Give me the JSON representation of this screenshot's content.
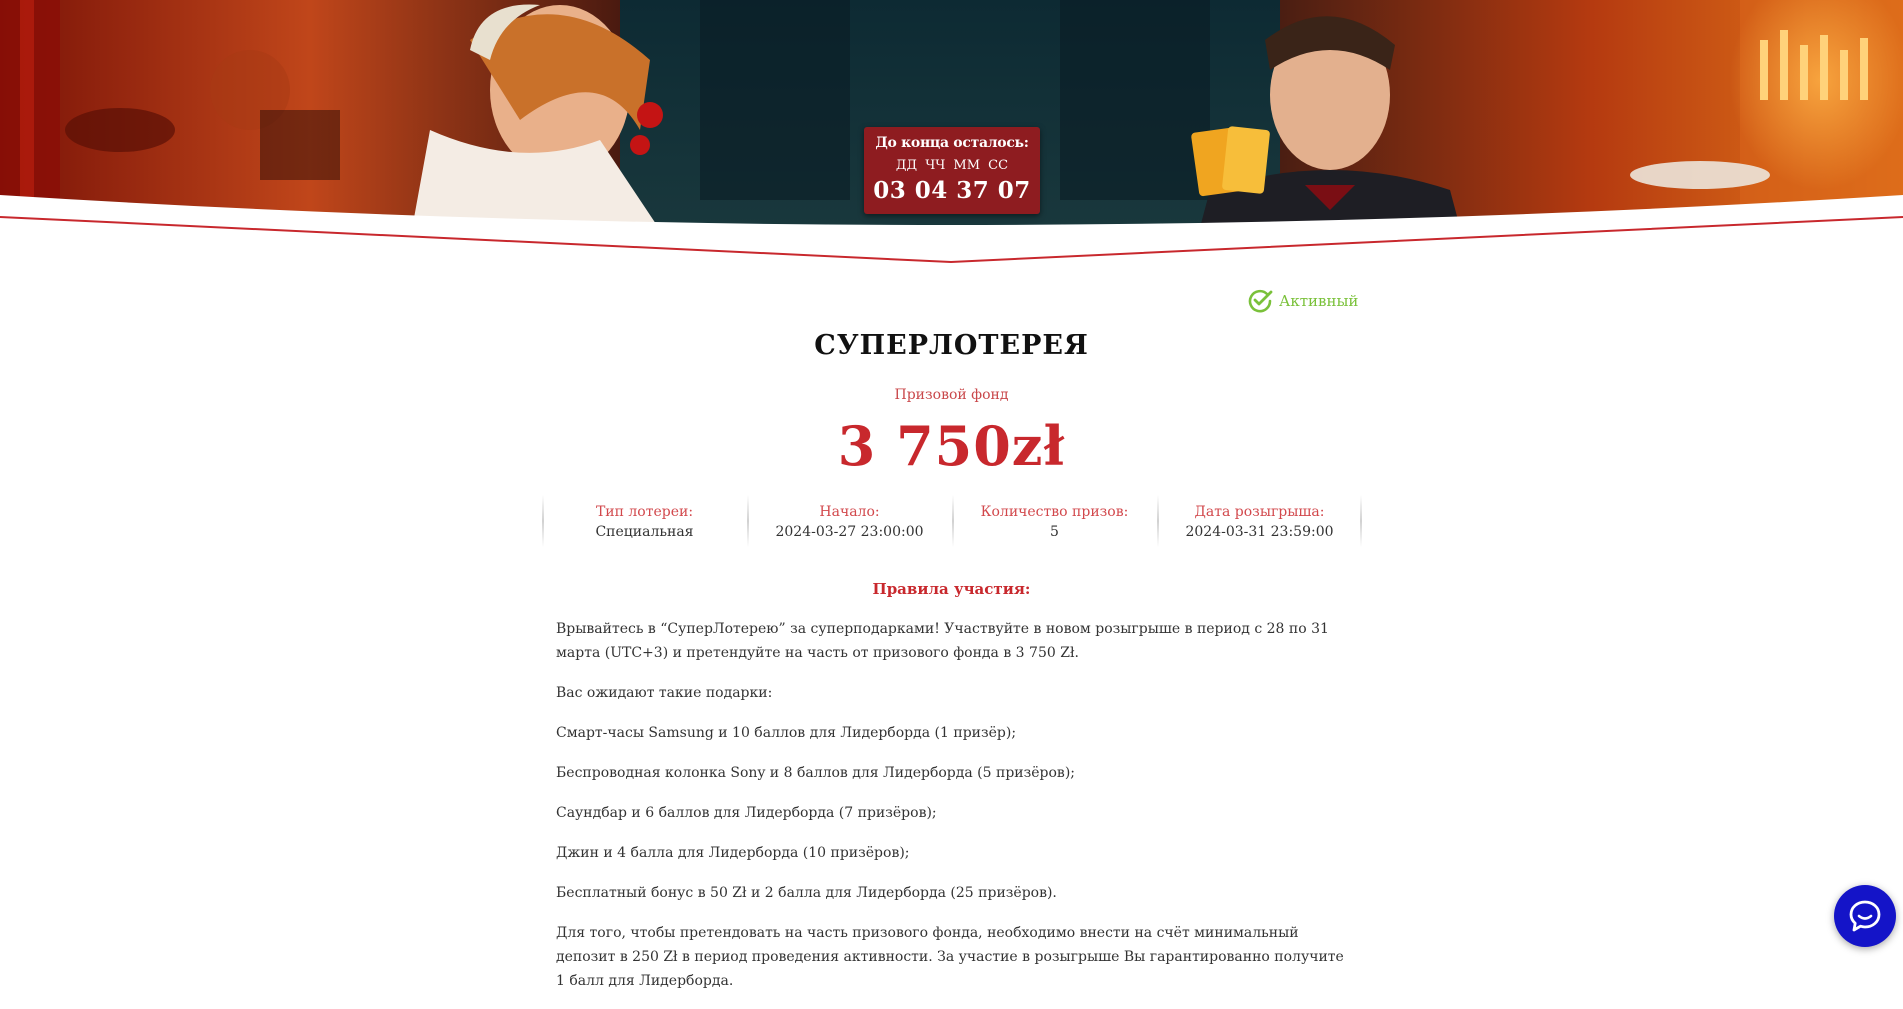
{
  "countdown": {
    "title": "До конца осталось:",
    "units": "ДД  ЧЧ  ММ  СС",
    "value": "03 04 37 07"
  },
  "status": {
    "label": "Активный",
    "color": "#7ac13a"
  },
  "lottery": {
    "title": "СУПЕРЛОТЕРЕЯ",
    "prize_fund_label": "Призовой фонд",
    "prize_fund_value": "3 750zł"
  },
  "info": [
    {
      "label": "Тип лотереи:",
      "value": "Специальная"
    },
    {
      "label": "Начало:",
      "value": "2024-03-27 23:00:00"
    },
    {
      "label": "Количество призов:",
      "value": "5"
    },
    {
      "label": "Дата розыгрыша:",
      "value": "2024-03-31 23:59:00"
    }
  ],
  "rules": {
    "title": "Правила участия:",
    "paragraphs": [
      "Врывайтесь в “СуперЛотерею” за суперподарками! Участвуйте в новом розыгрыше в период с 28 по 31 марта (UTC+3) и претендуйте на часть от призового фонда в 3 750 Zł.",
      "Вас ожидают такие подарки:",
      "Смарт-часы Samsung и 10 баллов для Лидерборда (1 призёр);",
      "Беспроводная колонка Sony и 8 баллов для Лидерборда (5 призёров);",
      "Саундбар и 6 баллов для Лидерборда (7 призёров);",
      "Джин и 4 балла для Лидерборда (10 призёров);",
      "Бесплатный бонус в 50 Zł и 2 балла для Лидерборда (25 призёров).",
      "Для того, чтобы претендовать на часть призового фонда, необходимо внести на счёт минимальный депозит в 250 Zł в период проведения активности. За участие в розыгрыше Вы гарантированно получите 1 балл для Лидерборда."
    ]
  },
  "colors": {
    "accent_red": "#c8282d",
    "timer_bg": "#8e1c20",
    "chat_blue": "#1414c8"
  },
  "icons": {
    "status": "check-circle-icon",
    "chat": "chat-bubble-icon"
  }
}
